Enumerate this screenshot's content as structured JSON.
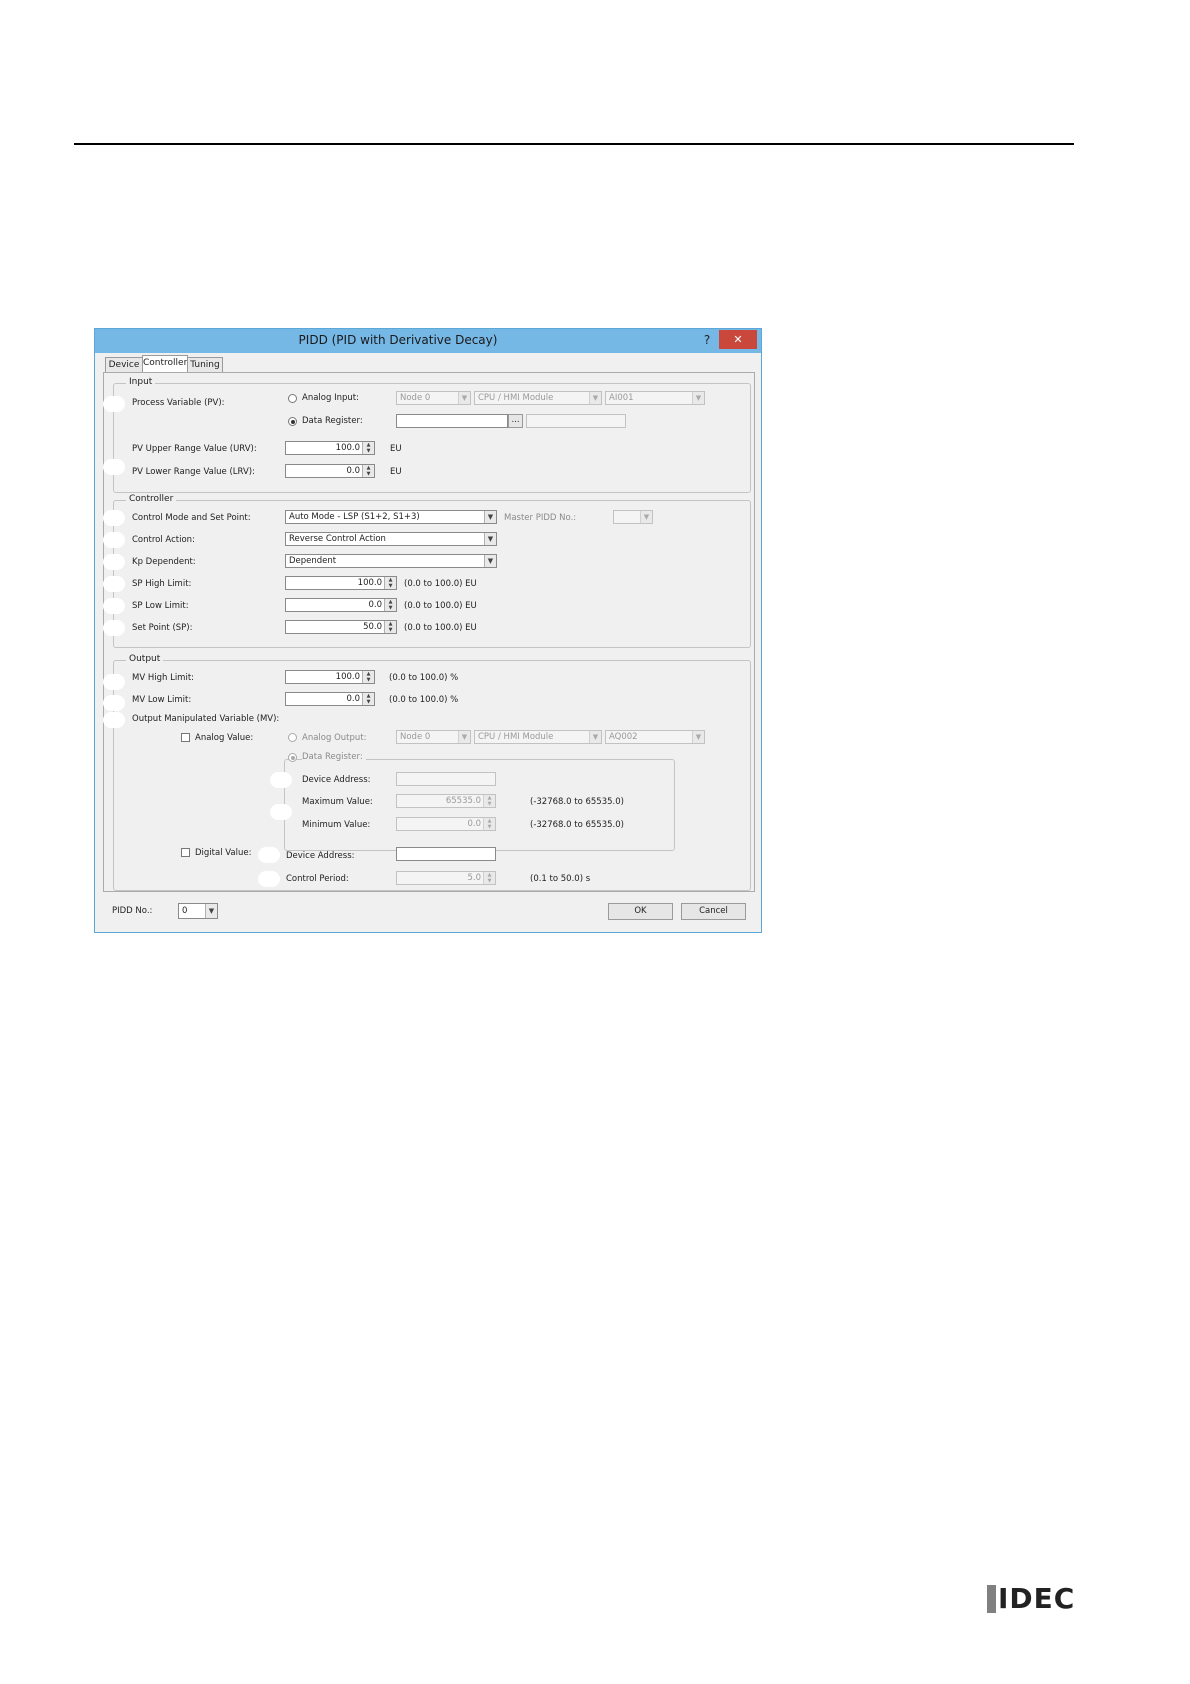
{
  "dialog": {
    "title": "PIDD (PID with Derivative Decay)",
    "help": "?",
    "close": "✕",
    "tabs": [
      "Device",
      "Controller",
      "Tuning"
    ]
  },
  "input": {
    "group": "Input",
    "pv_label": "Process Variable (PV):",
    "analog_input": {
      "label": "Analog Input:",
      "node": "Node 0",
      "module": "CPU / HMI Module",
      "channel": "AI001"
    },
    "data_register": {
      "label": "Data Register:",
      "value": "",
      "browse": "..."
    },
    "urv": {
      "label": "PV Upper Range Value (URV):",
      "value": "100.0",
      "unit": "EU"
    },
    "lrv": {
      "label": "PV Lower Range Value (LRV):",
      "value": "0.0",
      "unit": "EU"
    }
  },
  "controller": {
    "group": "Controller",
    "mode": {
      "label": "Control Mode and Set Point:",
      "value": "Auto Mode - LSP (S1+2, S1+3)",
      "master_label": "Master PIDD No.:"
    },
    "action": {
      "label": "Control Action:",
      "value": "Reverse Control Action"
    },
    "kp": {
      "label": "Kp Dependent:",
      "value": "Dependent"
    },
    "sp_high": {
      "label": "SP High Limit:",
      "value": "100.0",
      "range": "(0.0 to 100.0) EU"
    },
    "sp_low": {
      "label": "SP Low Limit:",
      "value": "0.0",
      "range": "(0.0 to 100.0) EU"
    },
    "sp": {
      "label": "Set Point (SP):",
      "value": "50.0",
      "range": "(0.0 to 100.0) EU"
    }
  },
  "output": {
    "group": "Output",
    "mv_high": {
      "label": "MV High Limit:",
      "value": "100.0",
      "range": "(0.0 to 100.0) %"
    },
    "mv_low": {
      "label": "MV Low Limit:",
      "value": "0.0",
      "range": "(0.0 to 100.0) %"
    },
    "mv_label": "Output Manipulated Variable (MV):",
    "analog_value": "Analog Value:",
    "analog_output": {
      "label": "Analog Output:",
      "node": "Node 0",
      "module": "CPU / HMI Module",
      "channel": "AQ002"
    },
    "data_register": "Data Register:",
    "device_address": "Device Address:",
    "maximum": {
      "label": "Maximum Value:",
      "value": "65535.0",
      "range": "(-32768.0 to 65535.0)"
    },
    "minimum": {
      "label": "Minimum Value:",
      "value": "0.0",
      "range": "(-32768.0 to 65535.0)"
    },
    "digital_value": "Digital Value:",
    "digital_device_address": "Device Address:",
    "control_period": {
      "label": "Control Period:",
      "value": "5.0",
      "range": "(0.1 to 50.0) s"
    }
  },
  "footer": {
    "pidd_label": "PIDD No.:",
    "pidd_value": "0",
    "ok": "OK",
    "cancel": "Cancel"
  },
  "logo": "IDEC"
}
